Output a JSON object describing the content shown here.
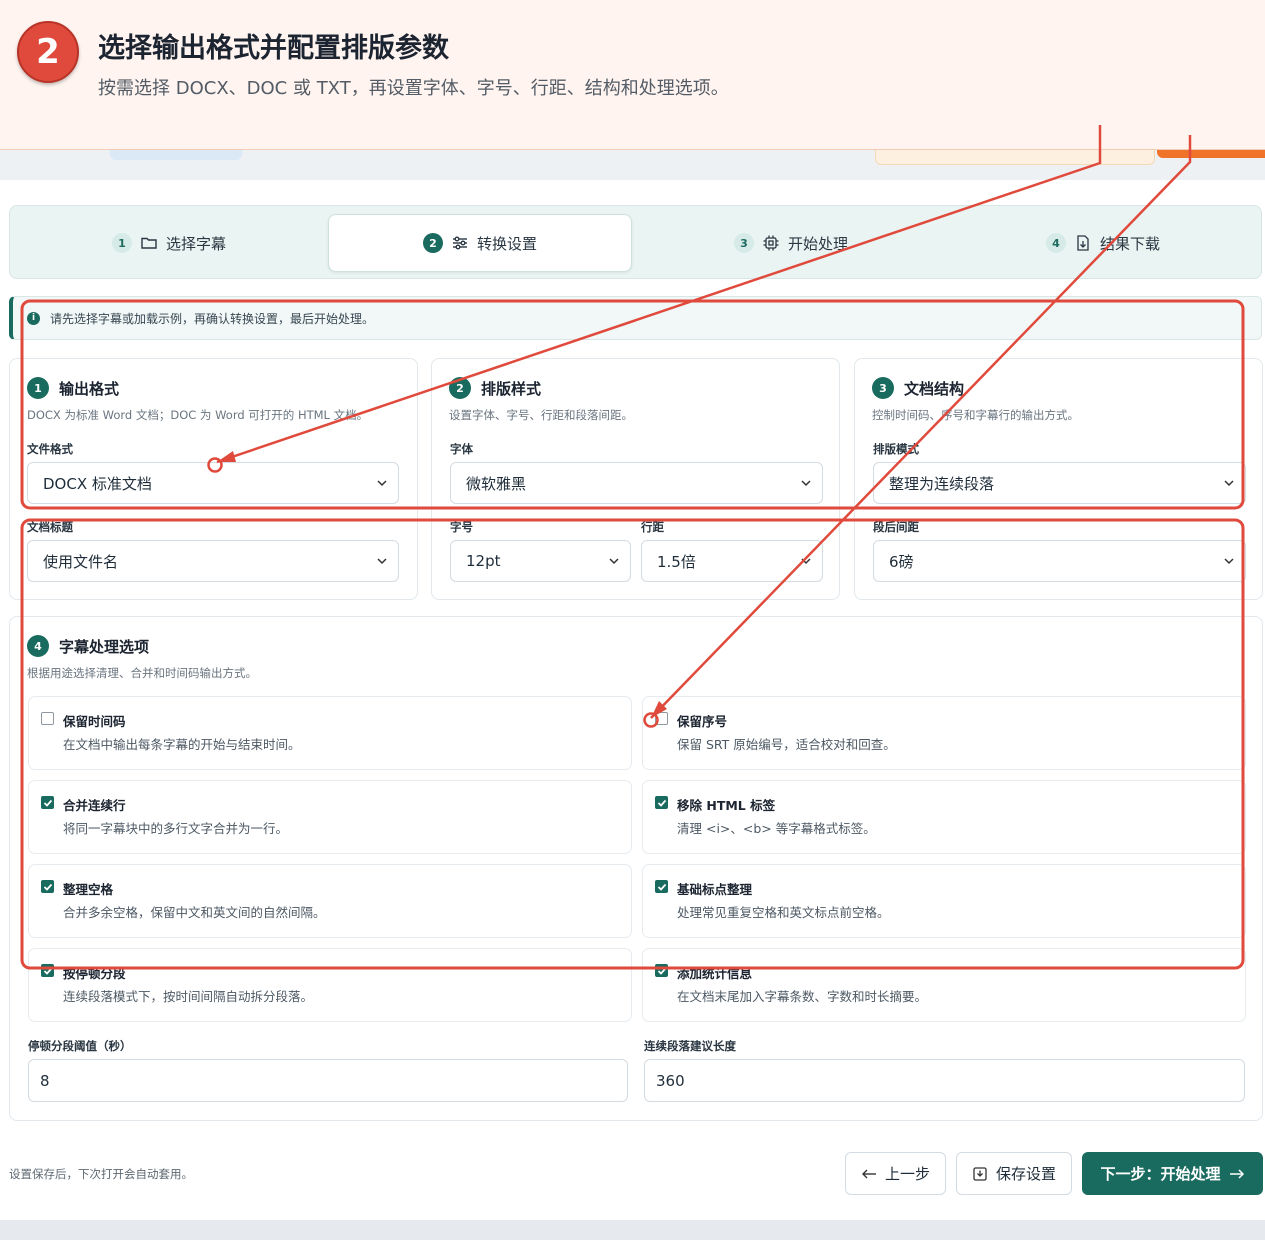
{
  "banner": {
    "step_number": "2",
    "title": "选择输出格式并配置排版参数",
    "subtitle": "按需选择 DOCX、DOC 或 TXT，再设置字体、字号、行距、结构和处理选项。"
  },
  "stepper": [
    {
      "num": "1",
      "label": "选择字幕",
      "icon": "folder-icon"
    },
    {
      "num": "2",
      "label": "转换设置",
      "icon": "sliders-icon"
    },
    {
      "num": "3",
      "label": "开始处理",
      "icon": "chip-icon"
    },
    {
      "num": "4",
      "label": "结果下载",
      "icon": "file-download-icon"
    }
  ],
  "info": "请先选择字幕或加载示例，再确认转换设置，最后开始处理。",
  "card1": {
    "num": "1",
    "title": "输出格式",
    "desc": "DOCX 为标准 Word 文档；DOC 为 Word 可打开的 HTML 文档。",
    "file_format_label": "文件格式",
    "file_format_value": "DOCX 标准文档",
    "doc_title_label": "文档标题",
    "doc_title_value": "使用文件名"
  },
  "card2": {
    "num": "2",
    "title": "排版样式",
    "desc": "设置字体、字号、行距和段落间距。",
    "font_label": "字体",
    "font_value": "微软雅黑",
    "size_label": "字号",
    "size_value": "12pt",
    "line_label": "行距",
    "line_value": "1.5倍"
  },
  "card3": {
    "num": "3",
    "title": "文档结构",
    "desc": "控制时间码、序号和字幕行的输出方式。",
    "layout_label": "排版模式",
    "layout_value": "整理为连续段落",
    "spacing_label": "段后间距",
    "spacing_value": "6磅"
  },
  "card4": {
    "num": "4",
    "title": "字幕处理选项",
    "desc": "根据用途选择清理、合并和时间码输出方式。",
    "options": [
      {
        "title": "保留时间码",
        "desc": "在文档中输出每条字幕的开始与结束时间。",
        "checked": false
      },
      {
        "title": "保留序号",
        "desc": "保留 SRT 原始编号，适合校对和回查。",
        "checked": false
      },
      {
        "title": "合并连续行",
        "desc": "将同一字幕块中的多行文字合并为一行。",
        "checked": true
      },
      {
        "title": "移除 HTML 标签",
        "desc": "清理 <i>、<b> 等字幕格式标签。",
        "checked": true
      },
      {
        "title": "整理空格",
        "desc": "合并多余空格，保留中文和英文间的自然间隔。",
        "checked": true
      },
      {
        "title": "基础标点整理",
        "desc": "处理常见重复空格和英文标点前空格。",
        "checked": true
      },
      {
        "title": "按停顿分段",
        "desc": "连续段落模式下，按时间间隔自动拆分段落。",
        "checked": true
      },
      {
        "title": "添加统计信息",
        "desc": "在文档末尾加入字幕条数、字数和时长摘要。",
        "checked": true
      }
    ],
    "pause_label": "停顿分段阈值（秒）",
    "pause_value": "8",
    "length_label": "连续段落建议长度",
    "length_value": "360"
  },
  "footer": {
    "note": "设置保存后，下次打开会自动套用。",
    "prev_label": "上一步",
    "save_label": "保存设置",
    "next_label": "下一步：开始处理"
  },
  "colors": {
    "accent": "#1a6b5f",
    "annotation_red": "#e04a3c",
    "banner_bg": "#fff4ef"
  }
}
